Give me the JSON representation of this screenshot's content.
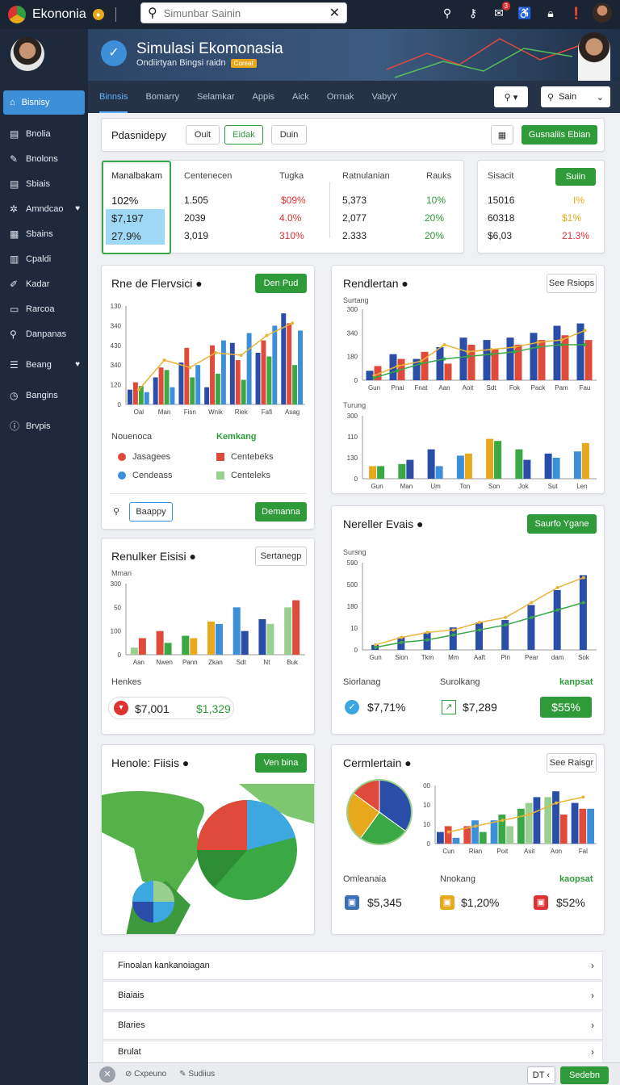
{
  "app": {
    "name": "Ekononia",
    "search_placeholder": "Simunbar Sainin"
  },
  "sidebar": {
    "active": "Bisnisy",
    "items": [
      {
        "label": "Bnolia",
        "icon": "doc-icon"
      },
      {
        "label": "Bnolons",
        "icon": "pencil-icon"
      },
      {
        "label": "Sbiais",
        "icon": "doc-icon"
      },
      {
        "label": "Amndcao",
        "icon": "gear-icon",
        "chevron": "♥"
      },
      {
        "label": "Sbains",
        "icon": "grid-icon"
      },
      {
        "label": "Cpaldi",
        "icon": "calendar-icon"
      },
      {
        "label": "Kadar",
        "icon": "edit-icon"
      },
      {
        "label": "Rarcoa",
        "icon": "folder-icon"
      },
      {
        "label": "Danpanas",
        "icon": "search-icon"
      },
      {
        "label": "Beang",
        "icon": "list-icon",
        "chevron": "♥"
      },
      {
        "label": "Bangins",
        "icon": "clock-icon"
      },
      {
        "label": "Brvpis",
        "icon": "info-icon"
      }
    ]
  },
  "hero": {
    "title": "Simulasi Ekomonasia",
    "subtitle": "Ondiirtyan Bingsi raidn",
    "tag": "Coreat"
  },
  "nav": {
    "tabs": [
      "Binnsis",
      "Bomarry",
      "Selamkar",
      "Appis",
      "Aick",
      "Orrnak",
      "VabyY"
    ],
    "dropdown": "Sain"
  },
  "toolbar": {
    "title": "Pdasnidepy",
    "buttons": [
      "Ouit",
      "Eidak",
      "Duin"
    ],
    "primary": "Gusnaliis Ebian"
  },
  "stats": {
    "c1": {
      "header": "Manalbakam",
      "rows": [
        "102%",
        "$7,197",
        "27.9%"
      ]
    },
    "c2": {
      "header": "Centenecen",
      "rows": [
        "1.505",
        "2039",
        "3,019"
      ]
    },
    "c3": {
      "header": "Tugka",
      "rows": [
        "$09%",
        "4.0%",
        "310%"
      ]
    },
    "c4": {
      "header": "Ratnulanian",
      "rows": [
        "5,373",
        "2,077",
        "2.333"
      ]
    },
    "c5": {
      "header": "Rauks",
      "rows": [
        "10%",
        "20%",
        "20%"
      ]
    },
    "c6": {
      "header": "Sisacit",
      "button": "Suiin",
      "rows": [
        "15016",
        "60318",
        "$6,03"
      ]
    },
    "c7": {
      "rows": [
        "I%",
        "$1%",
        "21.3%"
      ]
    }
  },
  "card1": {
    "title": "Rne de Flervsici",
    "button": "Den Pud",
    "legend_title": "Nouenoca",
    "legend_title2": "Kemkang",
    "legend": [
      "Jasagees",
      "Cendeass",
      "Centebeks",
      "Centeleks"
    ],
    "search_value": "Baappy",
    "action": "Demanna",
    "yticks": [
      "130",
      "340",
      "430",
      "340",
      "120",
      "0"
    ]
  },
  "card2": {
    "title": "Rendlertan",
    "button": "See Rsiops",
    "sub1": "Surtang",
    "sub2": "Turung",
    "yticks1": [
      "300",
      "340",
      "180",
      "0"
    ],
    "yticks2": [
      "300",
      "110",
      "130",
      "0"
    ]
  },
  "card3": {
    "title": "Renulker Eisisi",
    "button": "Sertanegp",
    "sub": "Mman",
    "yticks": [
      "300",
      "50",
      "100",
      "0"
    ],
    "section": "Henkes",
    "value1": "$7,001",
    "value2": "$1,329"
  },
  "card4": {
    "title": "Nereller Evais",
    "button": "Saurfo Ygane",
    "sub": "Sursng",
    "yticks": [
      "590",
      "500",
      "180",
      "10",
      "0"
    ],
    "labels": [
      "Siorlanag",
      "Surolkang",
      "kanpsat"
    ],
    "values": [
      "$7,71%",
      "$7,289",
      "$55%"
    ]
  },
  "card5": {
    "title": "Henole: Fiisis",
    "button": "Ven bina"
  },
  "card6": {
    "title": "Cermlertain",
    "button": "See Raisgr",
    "yticks": [
      "00",
      "10",
      "10",
      "0"
    ],
    "labels": [
      "Omleanaia",
      "Nnokang",
      "kaopsat"
    ],
    "values": [
      "$5,345",
      "$1,20%",
      "$52%"
    ]
  },
  "list": [
    "Finoalan kankanoiagan",
    "Biaiais",
    "Blaries",
    "Brulat"
  ],
  "footer": {
    "left": "Cxpeuno",
    "mid": "Sudiius",
    "page": "DT",
    "next": "Sedebn"
  },
  "chart_data": [
    {
      "type": "bar",
      "title": "Rne de Flervsici",
      "categories": [
        "Oal",
        "Man",
        "Fisn",
        "Wnik",
        "Riek",
        "Fafi",
        "Asag"
      ],
      "series": [
        {
          "values": [
            60,
            110,
            170,
            70,
            250,
            210,
            370
          ]
        },
        {
          "values": [
            90,
            150,
            230,
            240,
            180,
            260,
            330
          ]
        },
        {
          "values": [
            75,
            140,
            110,
            125,
            100,
            195,
            160
          ]
        },
        {
          "values": [
            50,
            70,
            160,
            260,
            290,
            320,
            300
          ]
        }
      ],
      "ylim": [
        0,
        400
      ]
    },
    {
      "type": "bar",
      "title": "Rendlertan",
      "categories": [
        "Gun",
        "Pnai",
        "Fnat",
        "Aan",
        "Aoit",
        "Sdt",
        "Fok",
        "Pack",
        "Pam",
        "Fau"
      ],
      "series": [
        {
          "values": [
            40,
            110,
            90,
            140,
            180,
            170,
            180,
            200,
            230,
            240
          ]
        },
        {
          "values": [
            60,
            90,
            120,
            70,
            150,
            130,
            150,
            170,
            190,
            170
          ]
        }
      ],
      "ylim": [
        0,
        300
      ]
    },
    {
      "type": "bar",
      "title": "Renulker Eisisi",
      "categories": [
        "Aan",
        "Nwen",
        "Pann",
        "Zkan",
        "Sdt",
        "Nt",
        "Buk"
      ],
      "series": [
        {
          "values": [
            30,
            100,
            80,
            140,
            200,
            150,
            200
          ]
        },
        {
          "values": [
            70,
            50,
            70,
            130,
            100,
            130,
            230
          ]
        }
      ],
      "ylim": [
        0,
        300
      ]
    },
    {
      "type": "bar",
      "title": "Nereller Evais",
      "categories": [
        "Gun",
        "Sion",
        "Tkm",
        "Mm",
        "Aaft",
        "Pin",
        "Pear",
        "dam",
        "Sok"
      ],
      "series": [
        {
          "values": [
            20,
            50,
            70,
            90,
            110,
            120,
            180,
            240,
            300
          ]
        }
      ],
      "ylim": [
        0,
        350
      ]
    },
    {
      "type": "pie",
      "title": "Cermlertain",
      "categories": [
        "Blue",
        "Green",
        "Yellow",
        "Red"
      ],
      "values": [
        35,
        25,
        25,
        15
      ]
    }
  ]
}
